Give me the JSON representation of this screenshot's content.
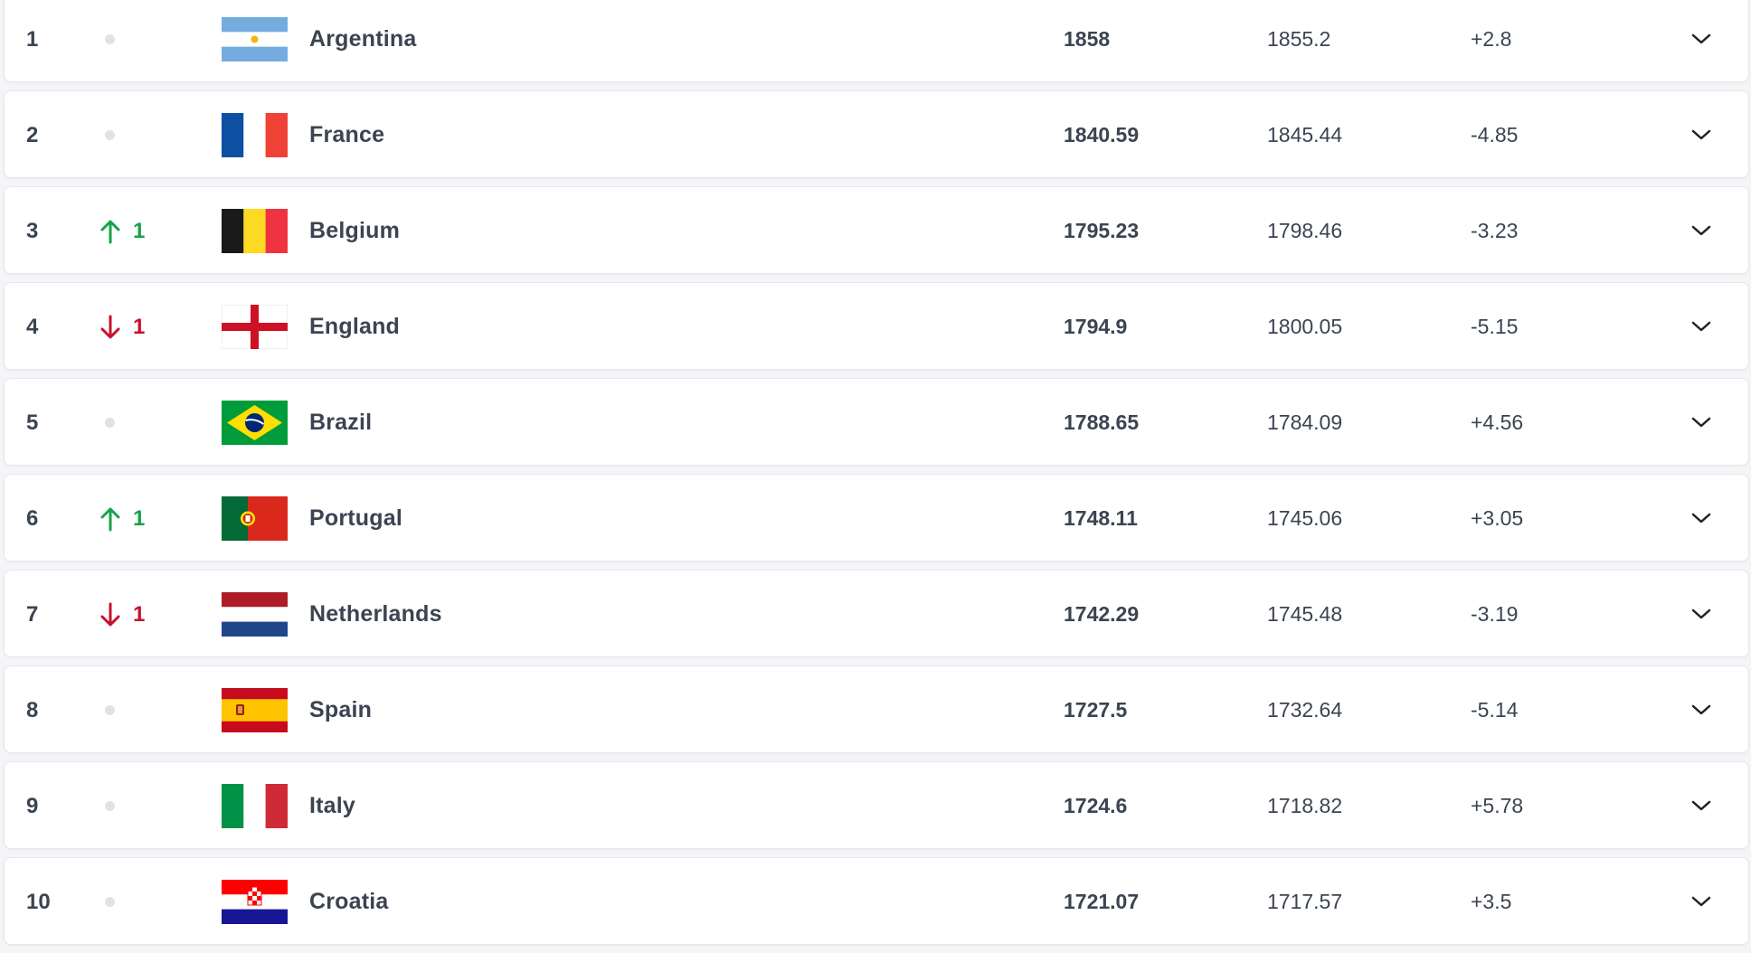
{
  "rankings": [
    {
      "rank": "1",
      "movement": "none",
      "movement_value": "",
      "country": "Argentina",
      "flag_icon": "argentina-flag-icon",
      "points": "1858",
      "previous_points": "1855.2",
      "change": "+2.8"
    },
    {
      "rank": "2",
      "movement": "none",
      "movement_value": "",
      "country": "France",
      "flag_icon": "france-flag-icon",
      "points": "1840.59",
      "previous_points": "1845.44",
      "change": "-4.85"
    },
    {
      "rank": "3",
      "movement": "up",
      "movement_value": "1",
      "country": "Belgium",
      "flag_icon": "belgium-flag-icon",
      "points": "1795.23",
      "previous_points": "1798.46",
      "change": "-3.23"
    },
    {
      "rank": "4",
      "movement": "down",
      "movement_value": "1",
      "country": "England",
      "flag_icon": "england-flag-icon",
      "points": "1794.9",
      "previous_points": "1800.05",
      "change": "-5.15"
    },
    {
      "rank": "5",
      "movement": "none",
      "movement_value": "",
      "country": "Brazil",
      "flag_icon": "brazil-flag-icon",
      "points": "1788.65",
      "previous_points": "1784.09",
      "change": "+4.56"
    },
    {
      "rank": "6",
      "movement": "up",
      "movement_value": "1",
      "country": "Portugal",
      "flag_icon": "portugal-flag-icon",
      "points": "1748.11",
      "previous_points": "1745.06",
      "change": "+3.05"
    },
    {
      "rank": "7",
      "movement": "down",
      "movement_value": "1",
      "country": "Netherlands",
      "flag_icon": "netherlands-flag-icon",
      "points": "1742.29",
      "previous_points": "1745.48",
      "change": "-3.19"
    },
    {
      "rank": "8",
      "movement": "none",
      "movement_value": "",
      "country": "Spain",
      "flag_icon": "spain-flag-icon",
      "points": "1727.5",
      "previous_points": "1732.64",
      "change": "-5.14"
    },
    {
      "rank": "9",
      "movement": "none",
      "movement_value": "",
      "country": "Italy",
      "flag_icon": "italy-flag-icon",
      "points": "1724.6",
      "previous_points": "1718.82",
      "change": "+5.78"
    },
    {
      "rank": "10",
      "movement": "none",
      "movement_value": "",
      "country": "Croatia",
      "flag_icon": "croatia-flag-icon",
      "points": "1721.07",
      "previous_points": "1717.57",
      "change": "+3.5"
    }
  ],
  "colors": {
    "up": "#16a34a",
    "down": "#c8102e",
    "neutral_dot": "#dfe3e8",
    "text": "#3b4450",
    "row_border": "#e4e7ec"
  },
  "icons": {
    "up": "arrow-up-icon",
    "down": "arrow-down-icon",
    "none": "neutral-dot-icon",
    "expand": "chevron-down-icon"
  }
}
